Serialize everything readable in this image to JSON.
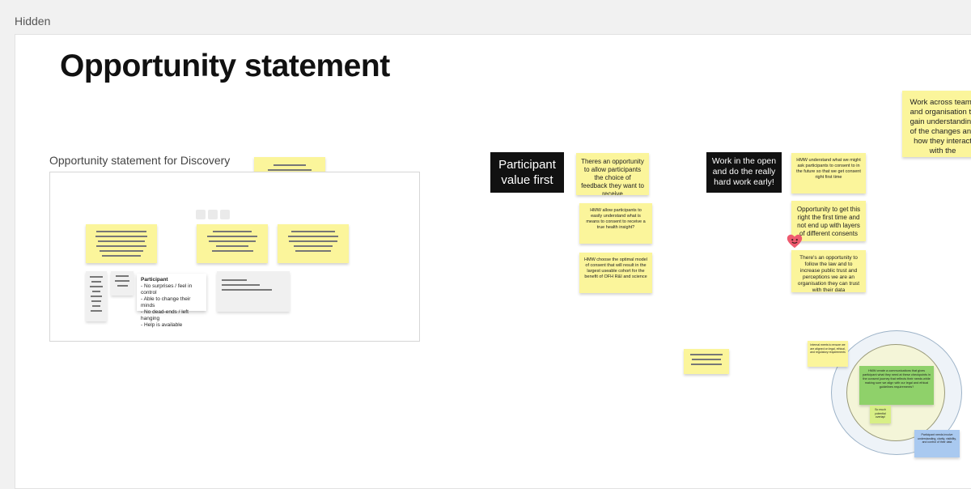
{
  "frame": {
    "label": "Hidden"
  },
  "board": {
    "title": "Opportunity statement",
    "discovery_label": "Opportunity statement for Discovery"
  },
  "participant_card": {
    "heading": "Participant",
    "lines": "- No surprises / feel in control\n- Able to change their minds\n- No dead-ends / left hanging\n- Help is available"
  },
  "labels": {
    "participant_value": "Participant value first",
    "work_in_open": "Work in the open and do the really hard work early!"
  },
  "stickies": {
    "s1": "Theres an opportunity to allow participants the choice of feedback they want to receive",
    "s2": "HMW allow participants to easily understand what is means to consent to receive a true health insight?",
    "s3": "HMW choose the optimal model of consent that will result in the largest useable cohort for the benefit of OFH R&I and science",
    "s4": "HMW understand what we might ask participants to consent to in the future so that we get consent right first time",
    "s5": "Opportunity to get this right the first time and not end up with layers of different consents",
    "s6": "There's an opportunity to follow the law and to increase public trust and perceptions we are an organisation they can trust with their data",
    "s7": "Work across teams and organisation to gain understanding of the changes and how they interact with the"
  },
  "venn": {
    "note_internal": "Internal meets to ensure we are aligned on legal, ethical, and regulatory requirements",
    "note_green": "HMW create a communications that gives participant what they need at these checkpoints in the consent journey that reflects their needs while making sure we align with our legal and ethical guidelines requirements?",
    "note_small": "So much potential overlap!",
    "note_blue": "Participant needs involve understanding, clarity, visibility, and control of their data"
  },
  "colors": {
    "sticky_yellow": "#fbf59b",
    "black_label": "#111111",
    "green_sticky": "#8fd16a",
    "blue_sticky": "#a9c9f0",
    "venn_outer": "#eef3f8",
    "venn_inner": "#f4f5d8"
  },
  "icons": {
    "reaction": "heart-face-icon"
  }
}
